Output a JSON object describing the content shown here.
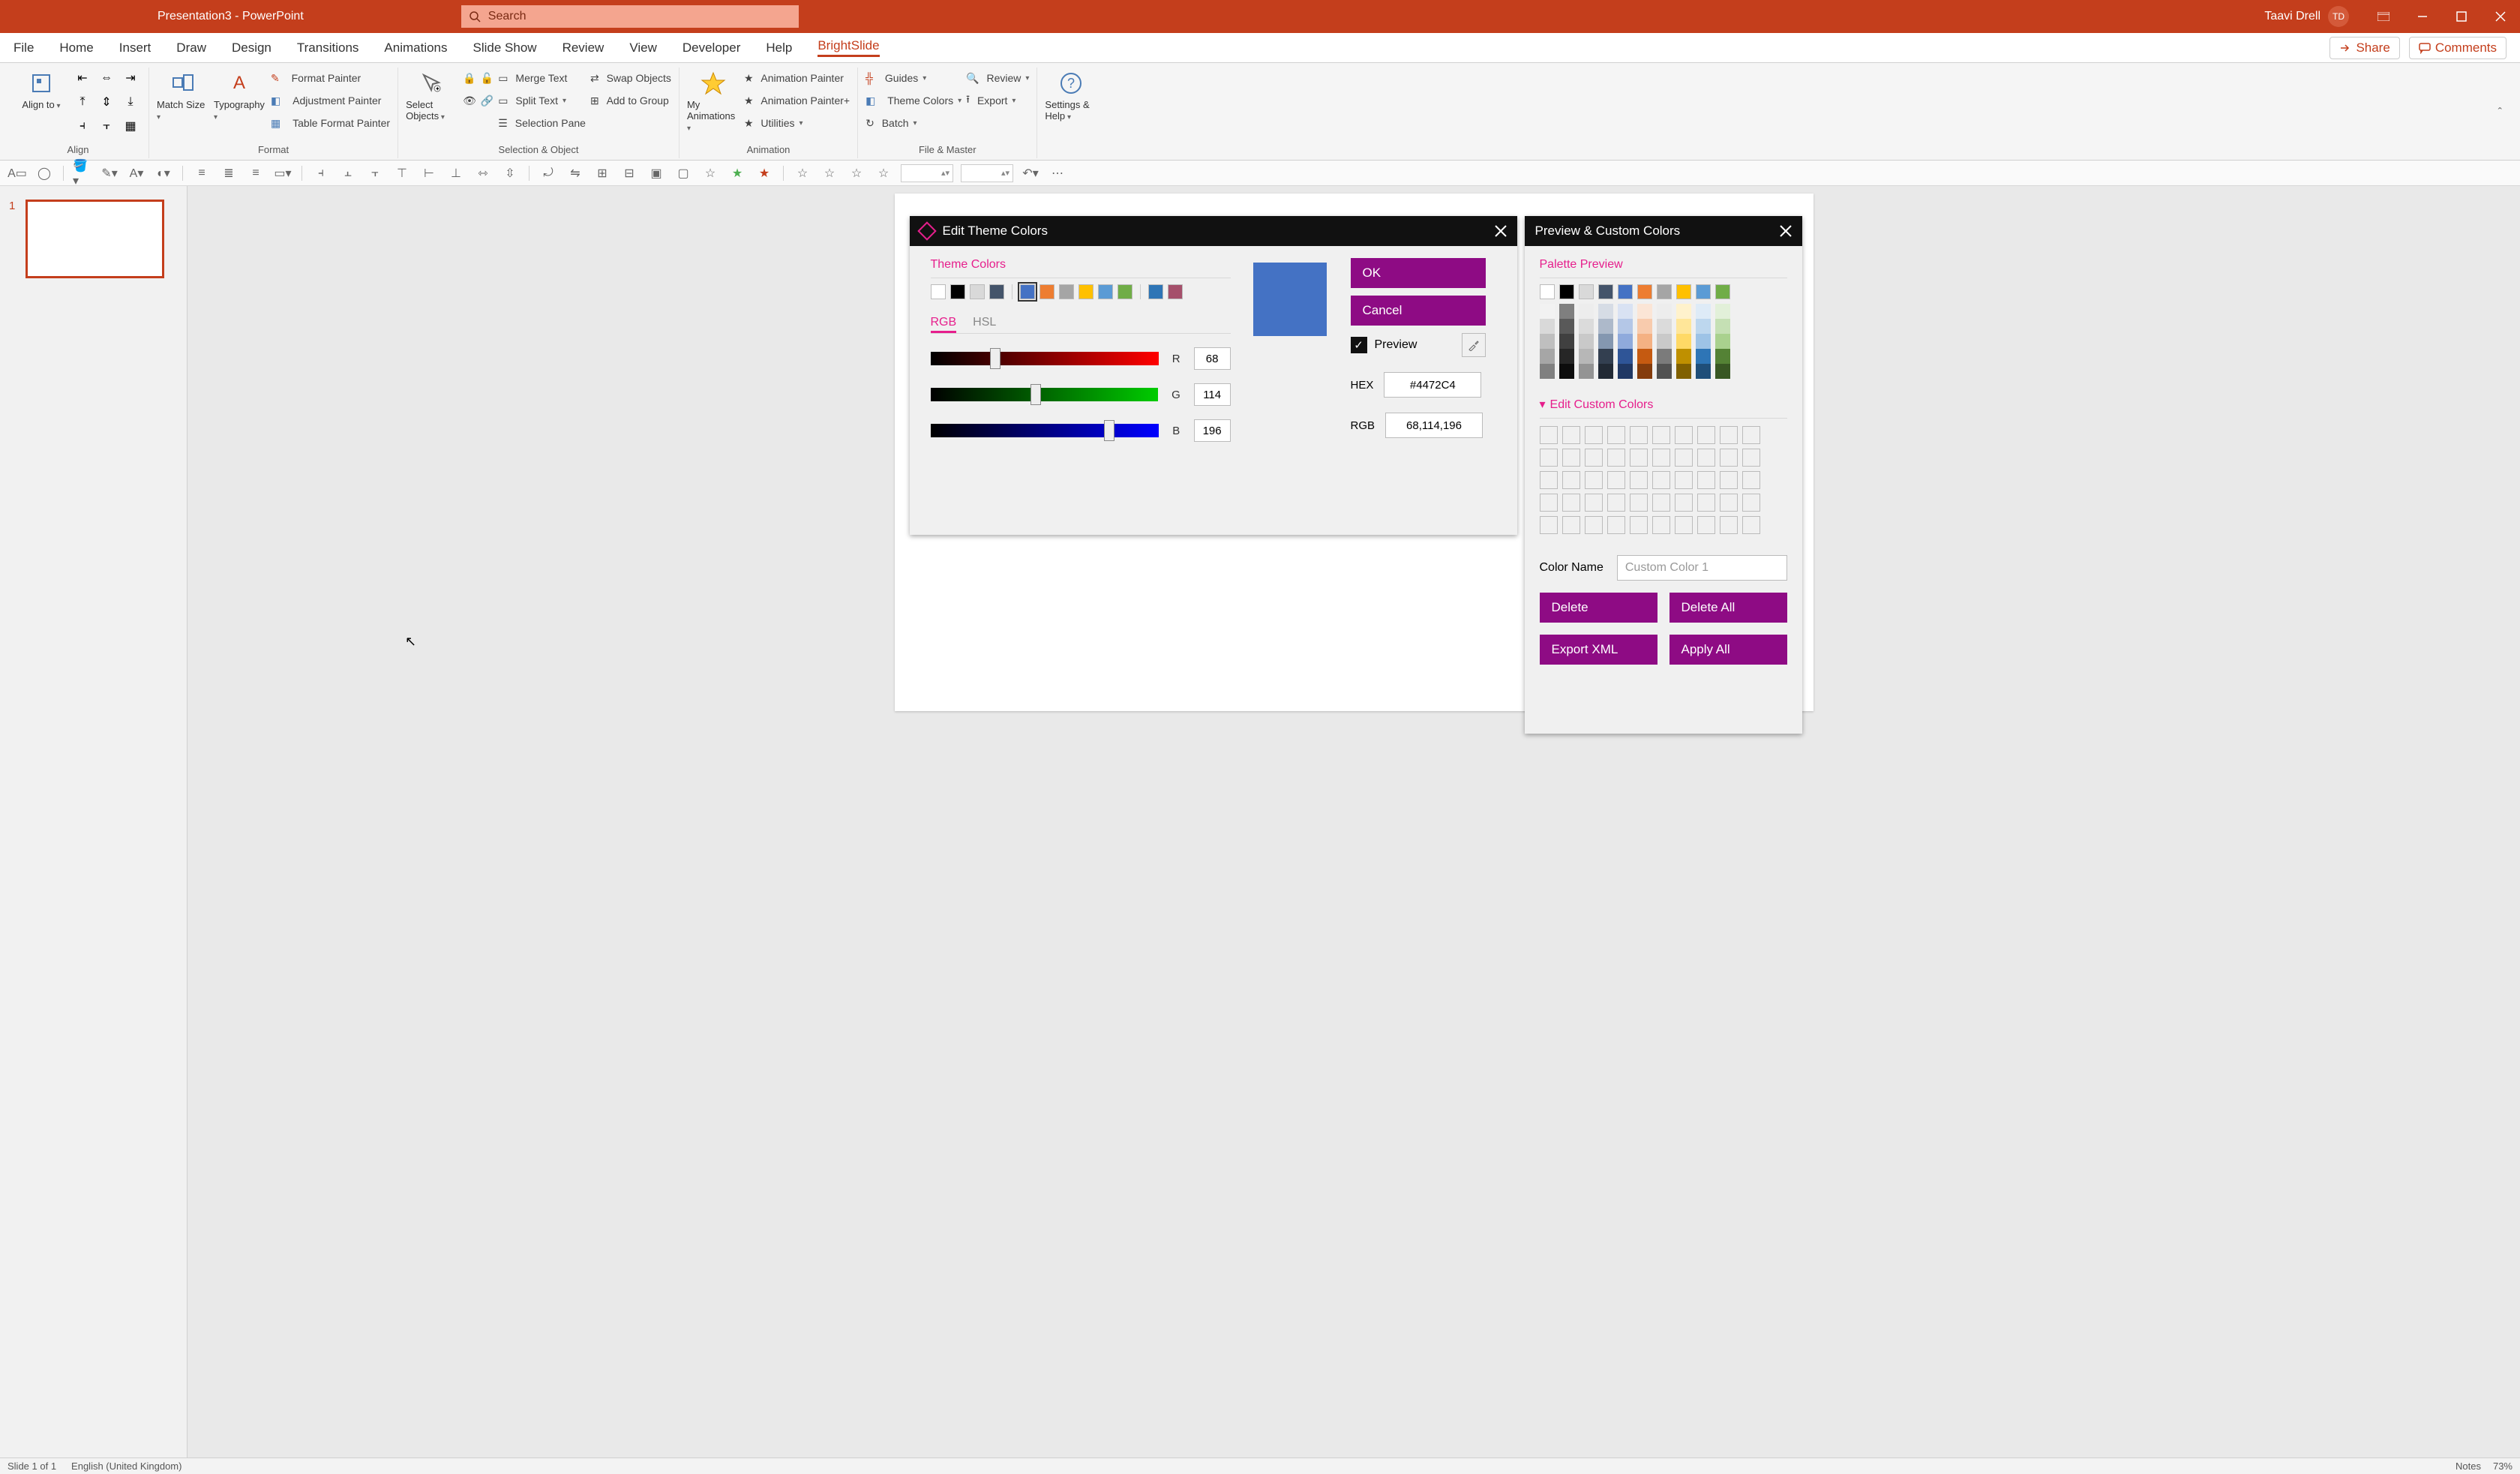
{
  "titlebar": {
    "title": "Presentation3 - PowerPoint",
    "search_placeholder": "Search",
    "user_name": "Taavi Drell",
    "user_initials": "TD"
  },
  "ribbon_tabs": [
    "File",
    "Home",
    "Insert",
    "Draw",
    "Design",
    "Transitions",
    "Animations",
    "Slide Show",
    "Review",
    "View",
    "Developer",
    "Help",
    "BrightSlide"
  ],
  "ribbon_active_tab": "BrightSlide",
  "share_label": "Share",
  "comments_label": "Comments",
  "ribbon": {
    "align": {
      "label": "Align",
      "align_to": "Align to",
      "match_size": "Match Size"
    },
    "format": {
      "label": "Format",
      "typography": "Typography",
      "items": [
        "Format Painter",
        "Adjustment Painter",
        "Table Format Painter"
      ]
    },
    "selection": {
      "label": "Selection & Object",
      "select_objects": "Select Objects",
      "items": [
        "Merge Text",
        "Swap Objects",
        "Split Text",
        "Add to Group",
        "Selection Pane"
      ]
    },
    "animation": {
      "label": "Animation",
      "my_anim": "My Animations",
      "items": [
        "Animation Painter",
        "Animation Painter+",
        "Utilities"
      ]
    },
    "filemaster": {
      "label": "File & Master",
      "items": [
        "Guides",
        "Theme Colors",
        "Batch",
        "Review",
        "Export"
      ]
    },
    "settings": {
      "label": "",
      "settings_help": "Settings & Help"
    }
  },
  "thumbs": {
    "slide_number": "1"
  },
  "dialog1": {
    "title": "Edit Theme Colors",
    "theme_colors_label": "Theme Colors",
    "rgb_tab": "RGB",
    "hsl_tab": "HSL",
    "r_label": "R",
    "g_label": "G",
    "b_label": "B",
    "r_val": "68",
    "g_val": "114",
    "b_val": "196",
    "ok": "OK",
    "cancel": "Cancel",
    "preview": "Preview",
    "hex_label": "HEX",
    "hex_val": "#4472C4",
    "rgb_label": "RGB",
    "rgb_val": "68,114,196",
    "theme_swatches": [
      "#ffffff",
      "#000000",
      "#d9d9d9",
      "#44546a",
      "#4472c4",
      "#ed7d31",
      "#a5a5a5",
      "#ffc000",
      "#5b9bd5",
      "#70ad47",
      "#2e75b6",
      "#a5506b"
    ],
    "selected_swatch_index": 4
  },
  "dialog2": {
    "title": "Preview & Custom Colors",
    "palette_preview": "Palette Preview",
    "edit_custom": "Edit Custom Colors",
    "color_name_label": "Color Name",
    "color_name_placeholder": "Custom Color 1",
    "delete": "Delete",
    "delete_all": "Delete All",
    "export_xml": "Export XML",
    "apply_all": "Apply All",
    "palette_base": [
      "#ffffff",
      "#000000",
      "#d9d9d9",
      "#44546a",
      "#4472c4",
      "#ed7d31",
      "#a5a5a5",
      "#ffc000",
      "#5b9bd5",
      "#70ad47"
    ],
    "palette_tints": [
      [
        "#f2f2f2",
        "#d9d9d9",
        "#bfbfbf",
        "#a6a6a6",
        "#808080"
      ],
      [
        "#7f7f7f",
        "#595959",
        "#404040",
        "#262626",
        "#0d0d0d"
      ],
      [
        "#ededed",
        "#dbdbdb",
        "#c9c9c9",
        "#b7b7b7",
        "#949494"
      ],
      [
        "#d6dce5",
        "#adb9ca",
        "#8497b0",
        "#333f50",
        "#222a35"
      ],
      [
        "#d9e2f3",
        "#b4c7e7",
        "#8faadc",
        "#2f5597",
        "#203864"
      ],
      [
        "#fbe5d6",
        "#f8cbad",
        "#f4b183",
        "#c55a11",
        "#843c0c"
      ],
      [
        "#ededed",
        "#dbdbdb",
        "#c9c9c9",
        "#7b7b7b",
        "#525252"
      ],
      [
        "#fff2cc",
        "#ffe699",
        "#ffd966",
        "#bf9000",
        "#806000"
      ],
      [
        "#deebf7",
        "#bdd7ee",
        "#9dc3e6",
        "#2e75b6",
        "#1f4e79"
      ],
      [
        "#e2f0d9",
        "#c5e0b4",
        "#a9d18e",
        "#548235",
        "#385723"
      ]
    ]
  },
  "statusbar": {
    "slide": "Slide 1 of 1",
    "lang": "English (United Kingdom)",
    "notes": "Notes",
    "zoom": "73%"
  }
}
